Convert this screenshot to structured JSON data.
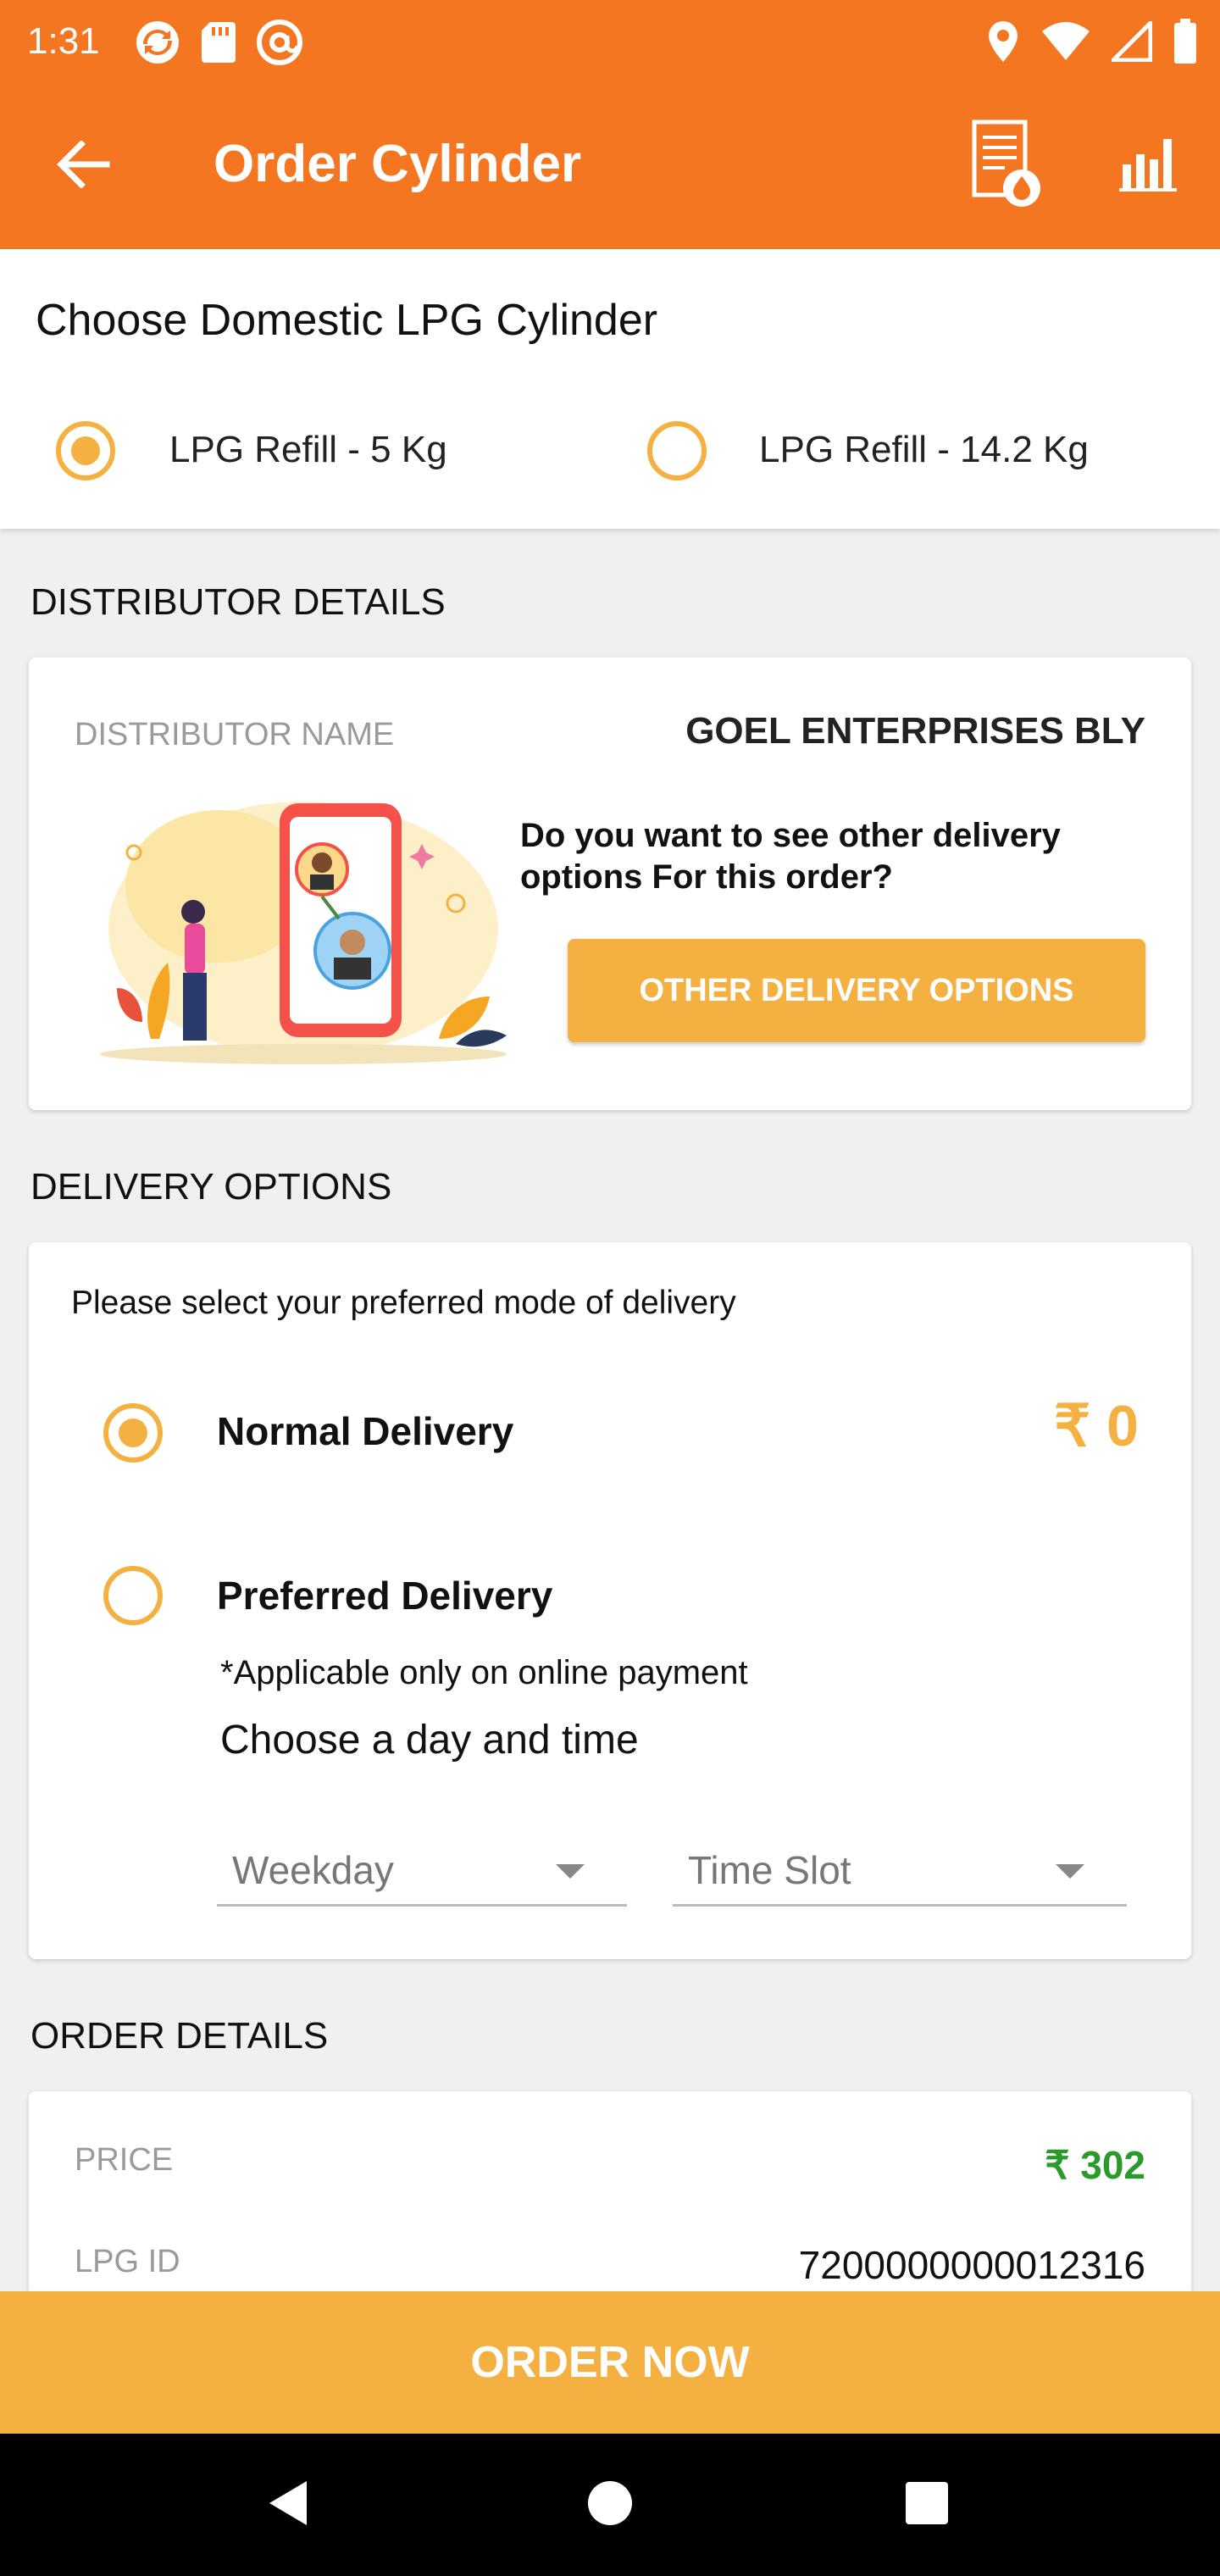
{
  "status_bar": {
    "time": "1:31",
    "left_icons": [
      "sync-icon",
      "sd-card-icon",
      "at-sign-icon"
    ],
    "right_icons": [
      "location-icon",
      "wifi-icon",
      "cell-signal-icon",
      "battery-icon"
    ]
  },
  "app_bar": {
    "title": "Order Cylinder",
    "back_icon": "arrow-left-icon",
    "actions": [
      "gas-document-icon",
      "bar-chart-icon"
    ]
  },
  "cylinder_choice": {
    "title": "Choose Domestic LPG Cylinder",
    "options": [
      {
        "label": "LPG Refill - 5 Kg",
        "selected": true
      },
      {
        "label": "LPG Refill - 14.2 Kg",
        "selected": false
      }
    ]
  },
  "distributor": {
    "section_title": "DISTRIBUTOR DETAILS",
    "name_label": "DISTRIBUTOR NAME",
    "name_value": "GOEL ENTERPRISES BLY",
    "question": "Do you want to see other delivery options For this order?",
    "button_label": "OTHER DELIVERY OPTIONS"
  },
  "delivery": {
    "section_title": "DELIVERY OPTIONS",
    "prompt": "Please select your preferred mode of delivery",
    "options": [
      {
        "label": "Normal Delivery",
        "price": "₹ 0",
        "selected": true
      },
      {
        "label": "Preferred Delivery",
        "selected": false
      }
    ],
    "note": "*Applicable only on online payment",
    "choose_text": "Choose a day and time",
    "weekday_placeholder": "Weekday",
    "timeslot_placeholder": "Time Slot"
  },
  "order_details": {
    "section_title": "ORDER DETAILS",
    "rows": [
      {
        "label": "PRICE",
        "value": "₹ 302"
      },
      {
        "label": "LPG ID",
        "value": "7200000000012316"
      }
    ]
  },
  "order_button": "ORDER NOW",
  "colors": {
    "primary": "#f47621",
    "accent": "#f5b042",
    "price_green": "#2a9a2a"
  },
  "nav_bar": [
    "back-triangle-icon",
    "home-circle-icon",
    "recents-square-icon"
  ]
}
